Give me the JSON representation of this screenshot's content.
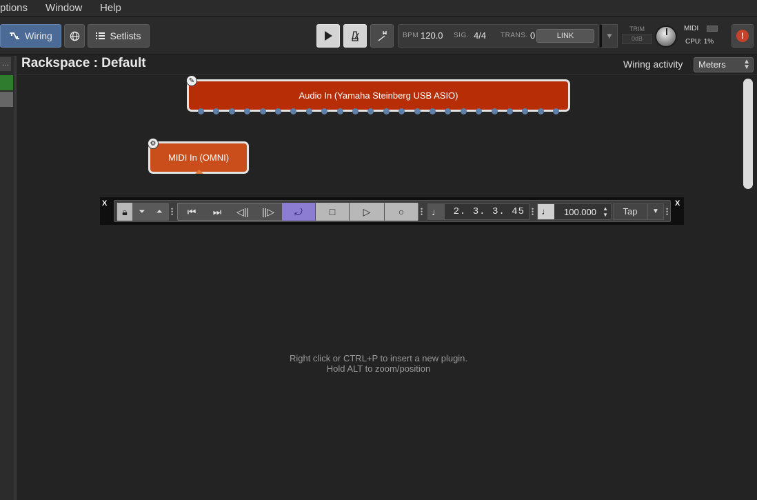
{
  "menu": {
    "items": [
      "ptions",
      "Window",
      "Help"
    ]
  },
  "toolbar": {
    "wiring_label": "Wiring",
    "setlists_label": "Setlists",
    "bpm_label": "BPM",
    "bpm_value": "120.0",
    "sig_label": "SIG.",
    "sig_value": "4/4",
    "trans_label": "TRANS.",
    "trans_value": "0",
    "link_label": "LINK",
    "trim_label": "TRIM",
    "trim_value": "0dB",
    "midi_label": "MIDI",
    "cpu_label": "CPU:",
    "cpu_value": "1%"
  },
  "header": {
    "title": "Rackspace : Default",
    "wiring_activity_label": "Wiring activity",
    "wiring_activity_value": "Meters"
  },
  "blocks": {
    "audio_in": "Audio In (Yamaha Steinberg USB ASIO)",
    "midi_in": "MIDI In (OMNI)"
  },
  "transport_bar": {
    "close_label": "X",
    "position": "2. 3. 3. 45",
    "tempo": "100.000",
    "tap_label": "Tap"
  },
  "hint": {
    "line1": "Right click or CTRL+P to insert a new plugin.",
    "line2": "Hold ALT to zoom/position"
  },
  "colors": {
    "audio_block": "#b72d06",
    "midi_block": "#c94e1c",
    "wiring_active": "#4c6a96",
    "loop_active": "#8c7cd2",
    "warning": "#c4432a"
  }
}
